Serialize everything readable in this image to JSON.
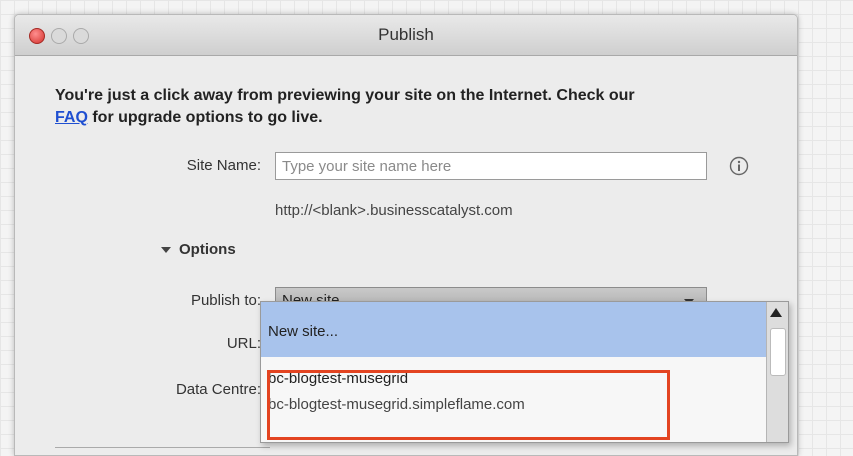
{
  "window": {
    "title": "Publish"
  },
  "intro": {
    "text_before": "You're just a click away from previewing your site on the Internet. Check our",
    "faq_link": "FAQ",
    "text_after": "for upgrade options to go live."
  },
  "site_name": {
    "label": "Site Name:",
    "value": "",
    "placeholder": "Type your site name here",
    "info_icon": "info-icon",
    "url_hint": "http://<blank>.businesscatalyst.com"
  },
  "options": {
    "toggle_label": "Options",
    "publish_to": {
      "label": "Publish to:",
      "selected": "New site..."
    },
    "url_label": "URL:",
    "data_centre_label": "Data Centre:",
    "dropdown": {
      "items": [
        "New site...",
        "bc-blogtest-musegrid",
        "bc-blogtest-musegrid.simpleflame.com"
      ]
    }
  },
  "colors": {
    "selection": "#a8c3ec",
    "highlight_box": "#e34421",
    "link": "#1f4fd1",
    "close_button": "#d3312c"
  }
}
